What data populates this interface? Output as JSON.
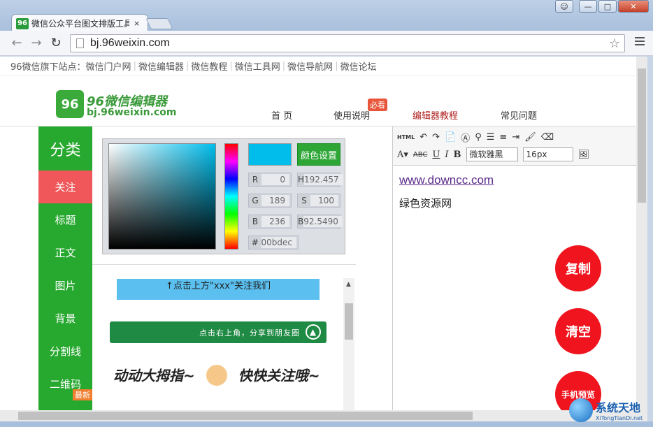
{
  "browser": {
    "tab_logo": "96",
    "tab_title": "微信公众平台图文排版工具",
    "tab_close": "×",
    "url": "bj.96weixin.com",
    "window_buttons": {
      "minimize": "—",
      "maximize": "□",
      "close": "✕"
    }
  },
  "site_links": {
    "prefix": "96微信旗下站点：",
    "items": [
      "微信门户网",
      "微信编辑器",
      "微信教程",
      "微信工具网",
      "微信导航网",
      "微信论坛"
    ]
  },
  "header": {
    "logo_mark": "96",
    "logo_title": "96微信编辑器",
    "logo_url": "bj.96weixin.com",
    "nav": [
      "首 页",
      "使用说明",
      "编辑器教程",
      "常见问题"
    ],
    "nav_badge": "必看"
  },
  "sidebar": {
    "title": "分类",
    "items": [
      "关注",
      "标题",
      "正文",
      "图片",
      "背景",
      "分割线",
      "二维码"
    ],
    "new_badge": "最新"
  },
  "color_picker": {
    "button": "颜色设置",
    "fields": [
      {
        "label": "R",
        "value": "0"
      },
      {
        "label": "H",
        "value": "192.457"
      },
      {
        "label": "G",
        "value": "189"
      },
      {
        "label": "S",
        "value": "100"
      },
      {
        "label": "B",
        "value": "236"
      },
      {
        "label": "B",
        "value": "92.5490"
      },
      {
        "label": "#",
        "value": "00bdec"
      }
    ],
    "current_color": "#00bdec"
  },
  "preview": {
    "banner1": "↑点击上方\"xxx\"关注我们",
    "banner2": "点击右上角，分享到朋友圈",
    "banner3_left": "动动大拇指~",
    "banner3_right": "快快关注哦~"
  },
  "editor": {
    "toolbar_html": "HTML",
    "font": "微软雅黑",
    "size": "16px",
    "link_text": "www.downcc.com",
    "body_text": "绿色资源网"
  },
  "actions": {
    "copy": "复制",
    "clear": "清空",
    "mobile_preview": "手机预览"
  },
  "watermark": {
    "title": "系统天地",
    "sub": "XiTongTianDi.net"
  },
  "colors": {
    "sidebar_green": "#27a82f",
    "active_red": "#f0575a",
    "action_red": "#f0141e"
  }
}
